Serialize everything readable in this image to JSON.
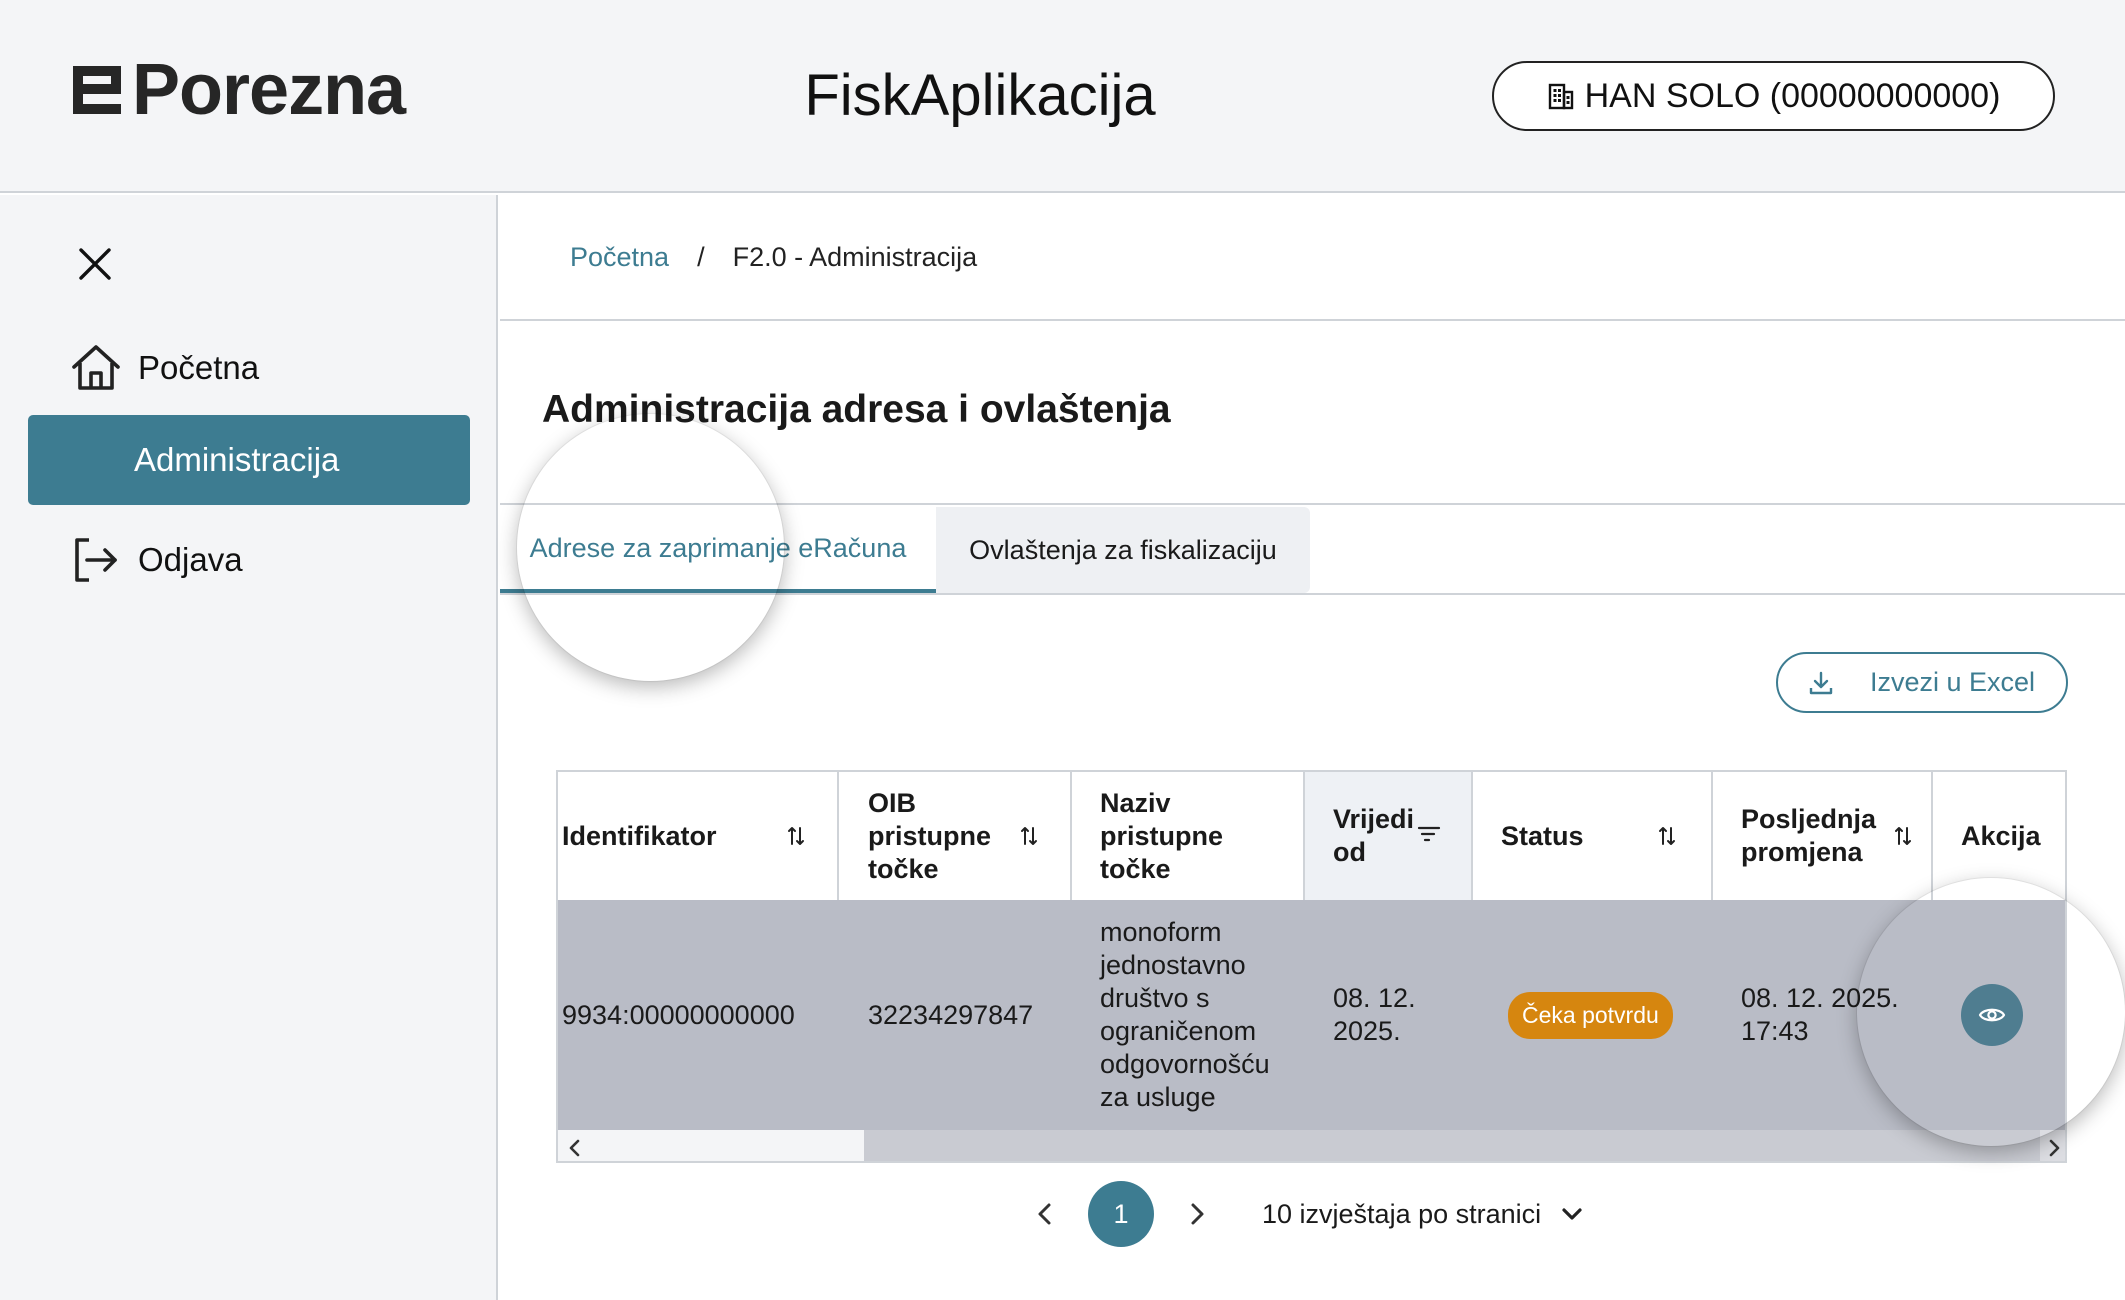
{
  "header": {
    "logo_text": "Porezna",
    "app_title": "FiskAplikacija",
    "user_badge": "HAN SOLO (00000000000)"
  },
  "sidebar": {
    "items": [
      {
        "label": "Početna",
        "icon": "home-icon"
      },
      {
        "label": "Administracija",
        "icon": "none",
        "active": true
      },
      {
        "label": "Odjava",
        "icon": "logout-icon"
      }
    ]
  },
  "breadcrumb": {
    "home": "Početna",
    "separator": "/",
    "current": "F2.0 - Administracija"
  },
  "page": {
    "title": "Administracija adresa i ovlaštenja"
  },
  "tabs": [
    {
      "label": "Adrese za zaprimanje eRačuna",
      "active": true
    },
    {
      "label": "Ovlaštenja za fiskalizaciju",
      "active": false
    }
  ],
  "export_button": "Izvezi u Excel",
  "table": {
    "columns": [
      {
        "key": "identifikator",
        "label": "Identifikator"
      },
      {
        "key": "oib",
        "label": "OIB pristupne točke"
      },
      {
        "key": "naziv",
        "label": "Naziv pristupne točke"
      },
      {
        "key": "vrijedi_od",
        "label": "Vrijedi od"
      },
      {
        "key": "status",
        "label": "Status"
      },
      {
        "key": "promjena",
        "label": "Posljednja promjena"
      },
      {
        "key": "akcija",
        "label": "Akcija"
      }
    ],
    "rows": [
      {
        "identifikator": "9934:00000000000",
        "oib": "32234297847",
        "naziv": "monoform jednostavno društvo s ograničenom odgovornošću za usluge",
        "vrijedi_od": "08. 12. 2025.",
        "status": "Čeka potvrdu",
        "promjena": "08. 12. 2025. 17:43"
      }
    ]
  },
  "pagination": {
    "current_page": "1",
    "per_page": "10 izvještaja po stranici"
  },
  "colors": {
    "accent": "#3d7c91",
    "status_pending": "#d6860f",
    "row_selected": "#b9bcc6"
  }
}
